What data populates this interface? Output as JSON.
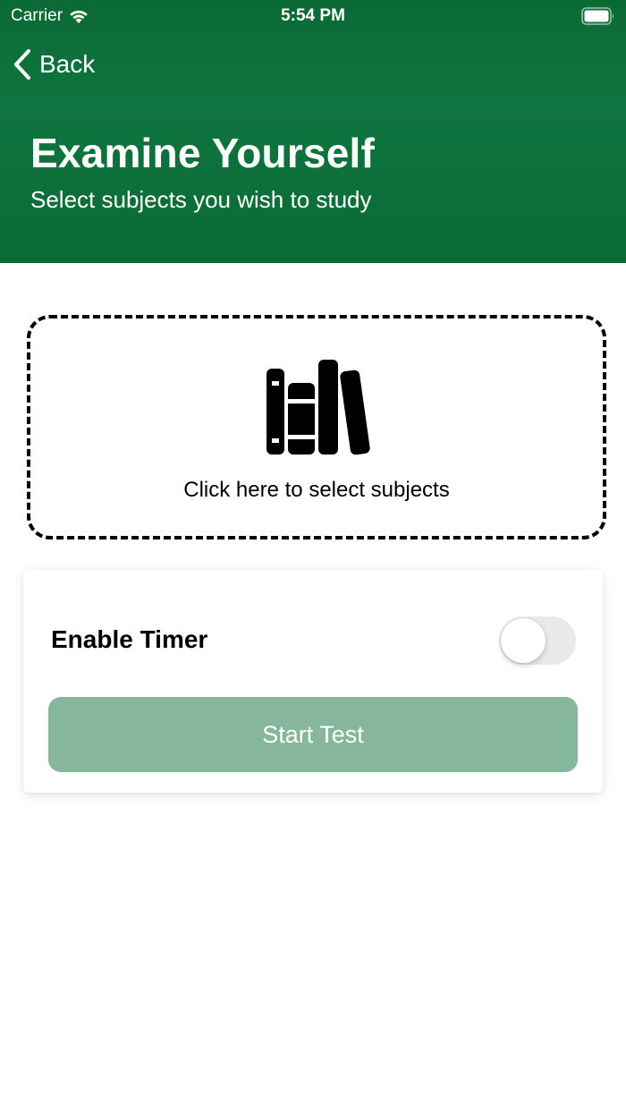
{
  "status_bar": {
    "carrier": "Carrier",
    "time": "5:54 PM",
    "wifi_icon": "wifi-icon",
    "battery_icon": "battery-icon"
  },
  "nav": {
    "back_label": "Back",
    "back_icon": "chevron-left-icon"
  },
  "header": {
    "title": "Examine Yourself",
    "subtitle": "Select subjects you wish to study"
  },
  "subject_picker": {
    "icon": "books-icon",
    "label": "Click here to select subjects"
  },
  "settings_card": {
    "timer_label": "Enable Timer",
    "timer_enabled": false,
    "start_button_label": "Start Test"
  },
  "colors": {
    "header_green": "#0f7540",
    "button_green_disabled": "#86b69b",
    "toggle_off": "#e9e9ea"
  }
}
